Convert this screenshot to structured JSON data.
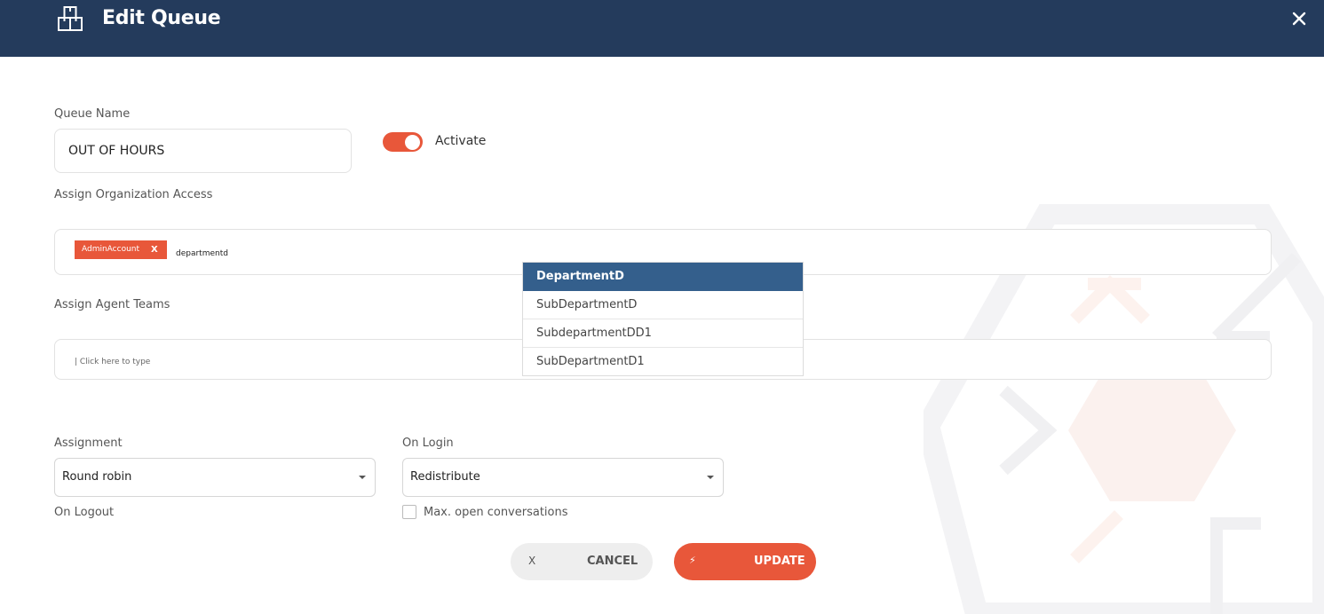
{
  "header": {
    "title": "Edit Queue",
    "icon": "queue-box-icon",
    "close_icon": "close-icon",
    "bg_color": "#243b5c"
  },
  "queue": {
    "label": "Queue Name",
    "value": "OUT OF HOURS"
  },
  "activate": {
    "label": "Activate",
    "on": true,
    "color": "#e8573a"
  },
  "organization": {
    "label": "Assign Organization Access",
    "tags": [
      {
        "label": "AdminAccount",
        "remove": "X"
      }
    ],
    "typed": "departmentd"
  },
  "dropdown": {
    "items": [
      {
        "label": "DepartmentD",
        "highlighted": true
      },
      {
        "label": "SubDepartmentD",
        "highlighted": false
      },
      {
        "label": "SubdepartmentDD1",
        "highlighted": false
      },
      {
        "label": "SubDepartmentD1",
        "highlighted": false
      }
    ],
    "highlight_color": "#345f8c"
  },
  "teams": {
    "label": "Assign Agent Teams",
    "placeholder": "| Click here to type"
  },
  "assignment": {
    "label": "Assignment",
    "selected": "Round robin"
  },
  "on_login": {
    "label": "On Login",
    "selected": "Redistribute"
  },
  "on_logout": {
    "label": "On Logout"
  },
  "max_open": {
    "label": "Max. open conversations",
    "checked": false
  },
  "buttons": {
    "cancel": {
      "icon_text": "X",
      "label": "CANCEL"
    },
    "update": {
      "icon": "lightning-bolt-icon",
      "label": "UPDATE",
      "color": "#e8573a"
    }
  }
}
